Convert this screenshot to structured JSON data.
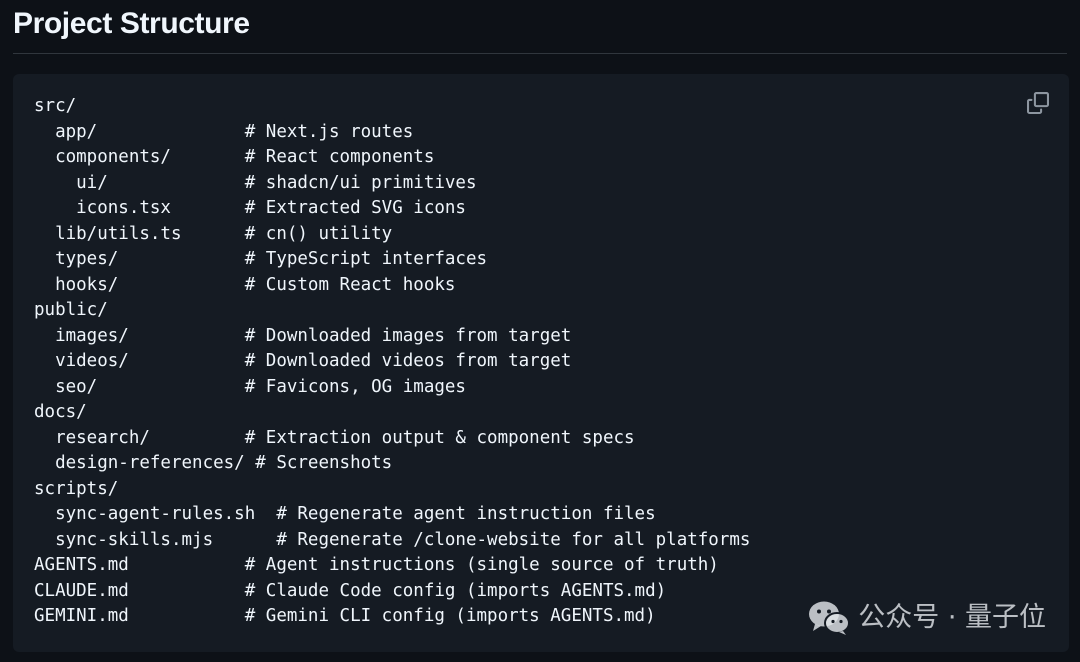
{
  "header": {
    "title": "Project Structure"
  },
  "code_block": {
    "lines": [
      "src/",
      "  app/              # Next.js routes",
      "  components/       # React components",
      "    ui/             # shadcn/ui primitives",
      "    icons.tsx       # Extracted SVG icons",
      "  lib/utils.ts      # cn() utility",
      "  types/            # TypeScript interfaces",
      "  hooks/            # Custom React hooks",
      "public/",
      "  images/           # Downloaded images from target",
      "  videos/           # Downloaded videos from target",
      "  seo/              # Favicons, OG images",
      "docs/",
      "  research/         # Extraction output & component specs",
      "  design-references/ # Screenshots",
      "scripts/",
      "  sync-agent-rules.sh  # Regenerate agent instruction files",
      "  sync-skills.mjs      # Regenerate /clone-website for all platforms",
      "AGENTS.md           # Agent instructions (single source of truth)",
      "CLAUDE.md           # Claude Code config (imports AGENTS.md)",
      "GEMINI.md           # Gemini CLI config (imports AGENTS.md)"
    ],
    "copy_icon": "copy-icon"
  },
  "watermark": {
    "logo_icon": "wechat-icon",
    "text": "公众号 · 量子位"
  },
  "colors": {
    "page_background": "#0d1117",
    "code_background": "#151b23",
    "text": "#f0f6fc",
    "divider": "#30363d",
    "icon": "#8d96a0"
  }
}
